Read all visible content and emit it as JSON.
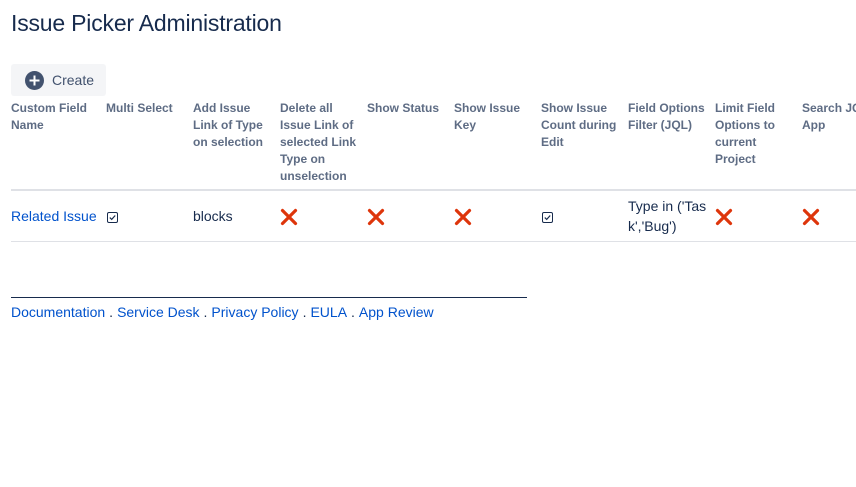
{
  "page": {
    "title": "Issue Picker Administration"
  },
  "toolbar": {
    "create_label": "Create",
    "create_icon": "plus-circle-icon"
  },
  "table": {
    "headers": [
      "Custom Field Name",
      "Multi Select",
      "Add Issue Link of Type on selection",
      "Delete all Issue Link of selected Link Type on unselection",
      "Show Status",
      "Show Issue Key",
      "Show Issue Count during Edit",
      "Field Options Filter (JQL)",
      "Limit Field Options to current Project",
      "Search JQL as App"
    ],
    "rows": [
      {
        "custom_field_name": "Related Issue",
        "multi_select": "checked",
        "add_issue_link_type": "blocks",
        "delete_all_issue_link": "cross",
        "show_status": "cross",
        "show_issue_key": "cross",
        "show_issue_count": "checked",
        "field_options_filter": "Type in ('Task','Bug')",
        "limit_field_options": "cross",
        "search_jql_as_app": "cross"
      }
    ]
  },
  "footer": {
    "links": [
      "Documentation",
      "Service Desk",
      "Privacy Policy",
      "EULA",
      "App Review"
    ],
    "separator": "."
  },
  "colors": {
    "link": "#0052cc",
    "cross": "#de350b",
    "text": "#172b4d",
    "header_text": "#5e6c84"
  }
}
